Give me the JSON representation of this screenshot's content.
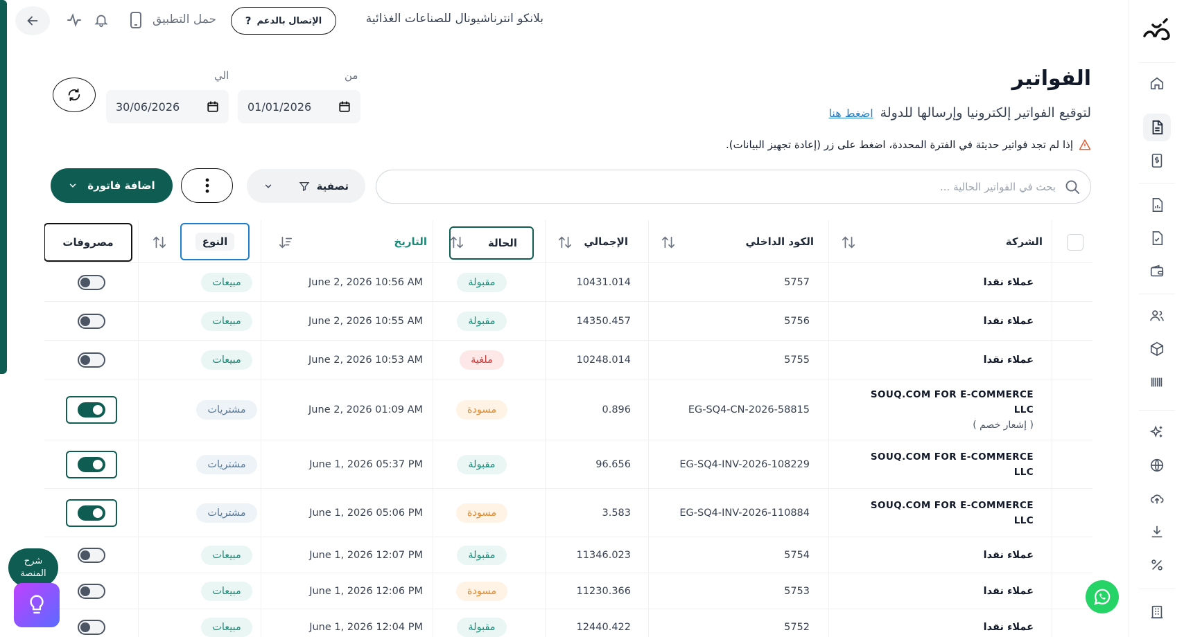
{
  "topbar": {
    "company_name": "بلانكو انترناشيونال للصناعات الغذائية",
    "support_label": "الإتصال بالدعم",
    "support_icon": "?",
    "download_app_label": "حمل التطبيق"
  },
  "header": {
    "title": "الفواتير",
    "subtitle": "لتوقيع الفواتير إلكترونيا وإرسالها للدولة",
    "subtitle_link": "اضغط هنا",
    "notice": "إذا لم تجد فواتير حديثة في الفترة المحددة، اضغط على زر (إعادة تجهيز البيانات)."
  },
  "filters": {
    "from_label": "من",
    "from_value": "01/01/2026",
    "to_label": "الي",
    "to_value": "30/06/2026"
  },
  "toolbar": {
    "search_placeholder": "بحث في الفواتير الحالية ...",
    "filter_label": "تصفية",
    "add_label": "اضافة فاتورة"
  },
  "table": {
    "headers": {
      "company": "الشركة",
      "code": "الكود الداخلي",
      "total": "الإجمالي",
      "status": "الحالة",
      "date": "التاريخ",
      "type": "النوع",
      "expenses": "مصروفات"
    },
    "rows": [
      {
        "company": "عملاء نقدا",
        "code": "5757",
        "total": "10431.014",
        "status": "مقبولة",
        "date": "June 2, 2026 10:56 AM",
        "type": "مبيعات",
        "expense": false
      },
      {
        "company": "عملاء نقدا",
        "code": "5756",
        "total": "14350.457",
        "status": "مقبولة",
        "date": "June 2, 2026 10:55 AM",
        "type": "مبيعات",
        "expense": false
      },
      {
        "company": "عملاء نقدا",
        "code": "5755",
        "total": "10248.014",
        "status": "ملغية",
        "date": "June 2, 2026 10:53 AM",
        "type": "مبيعات",
        "expense": false
      },
      {
        "company_line1": "SOUQ.COM FOR E-COMMERCE",
        "company_line2": "LLC",
        "company_note": "( إشعار خصم )",
        "code": "EG-SQ4-CN-2026-58815",
        "total": "0.896",
        "status": "مسودة",
        "date": "June 2, 2026 01:09 AM",
        "type": "مشتريات",
        "expense": true
      },
      {
        "company_line1": "SOUQ.COM FOR E-COMMERCE",
        "company_line2": "LLC",
        "code": "EG-SQ4-INV-2026-108229",
        "total": "96.656",
        "status": "مقبولة",
        "date": "June 1, 2026 05:37 PM",
        "type": "مشتريات",
        "expense": true
      },
      {
        "company_line1": "SOUQ.COM FOR E-COMMERCE",
        "company_line2": "LLC",
        "code": "EG-SQ4-INV-2026-110884",
        "total": "3.583",
        "status": "مسودة",
        "date": "June 1, 2026 05:06 PM",
        "type": "مشتريات",
        "expense": true
      },
      {
        "company": "عملاء نقدا",
        "code": "5754",
        "total": "11346.023",
        "status": "مقبولة",
        "date": "June 1, 2026 12:07 PM",
        "type": "مبيعات",
        "expense": false
      },
      {
        "company": "عملاء نقدا",
        "code": "5753",
        "total": "11230.366",
        "status": "مسودة",
        "date": "June 1, 2026 12:06 PM",
        "type": "مبيعات",
        "expense": false
      },
      {
        "company": "عملاء نقدا",
        "code": "5752",
        "total": "12440.422",
        "status": "مقبولة",
        "date": "June 1, 2026 12:04 PM",
        "type": "مبيعات",
        "expense": false
      }
    ]
  },
  "help": {
    "bubble_line1": "شرح",
    "bubble_line2": "المنصة"
  },
  "colors": {
    "brand": "#0f5d52",
    "accepted": "#1b8a78",
    "cancelled": "#d23a3a",
    "draft": "#e08a2e",
    "whatsapp": "#25d366"
  }
}
